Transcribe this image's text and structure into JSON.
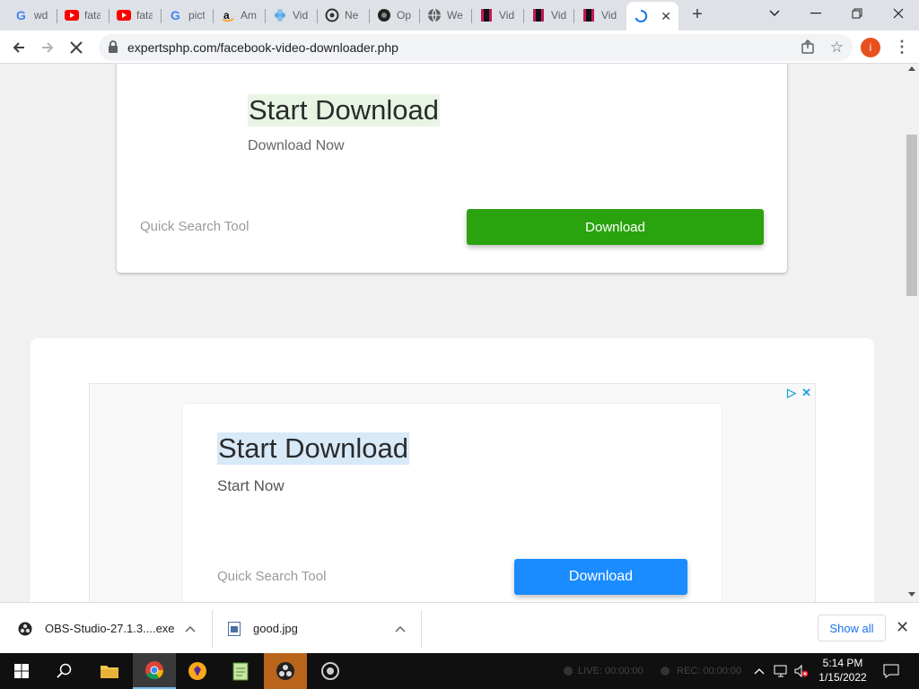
{
  "browser": {
    "tabs": [
      {
        "label": "wd",
        "favicon": "google-icon"
      },
      {
        "label": "fata",
        "favicon": "youtube-icon"
      },
      {
        "label": "fata",
        "favicon": "youtube-icon"
      },
      {
        "label": "pict",
        "favicon": "google-icon"
      },
      {
        "label": "Am",
        "favicon": "amazon-icon"
      },
      {
        "label": "Vid",
        "favicon": "vimeo-icon"
      },
      {
        "label": "Ne",
        "favicon": "chatgpt-icon"
      },
      {
        "label": "Op",
        "favicon": "openai-icon"
      },
      {
        "label": "We",
        "favicon": "globe-icon"
      },
      {
        "label": "Vid",
        "favicon": "video-icon"
      },
      {
        "label": "Vid",
        "favicon": "video-icon"
      },
      {
        "label": "Vid",
        "favicon": "video-icon"
      }
    ],
    "active_tab": {
      "favicon": "loading-spinner-icon",
      "close": "✕"
    },
    "new_tab": "+",
    "window_controls": {
      "tab_search": "⌄",
      "minimize": "—",
      "restore": "❐",
      "close": "✕"
    },
    "url": "expertsphp.com/facebook-video-downloader.php",
    "profile_initial": "i",
    "menu": "⋮"
  },
  "page": {
    "card1": {
      "heading": "Start Download",
      "subheading": "Download Now",
      "quick_search": "Quick Search Tool",
      "button": "Download",
      "button_color": "#2aa30e"
    },
    "ad": {
      "heading": "Start Download",
      "subheading": "Start Now",
      "quick_search": "Quick Search Tool",
      "button": "Download",
      "button_color": "#1a8cff",
      "adchoices": "▷",
      "close": "✕"
    }
  },
  "downloads": {
    "items": [
      {
        "name": "OBS-Studio-27.1.3....exe",
        "icon": "obs-icon"
      },
      {
        "name": "good.jpg",
        "icon": "image-file-icon"
      }
    ],
    "show_all": "Show all",
    "close": "✕"
  },
  "taskbar": {
    "apps": [
      "start-icon",
      "search-icon",
      "file-explorer-icon",
      "chrome-icon",
      "brave-icon",
      "notepad-icon",
      "obs-icon",
      "obs-recorder-icon"
    ],
    "obs_status": {
      "live": "LIVE: 00:00:00",
      "rec": "REC: 00:00:00"
    },
    "time": "5:14 PM",
    "date": "1/15/2022"
  }
}
